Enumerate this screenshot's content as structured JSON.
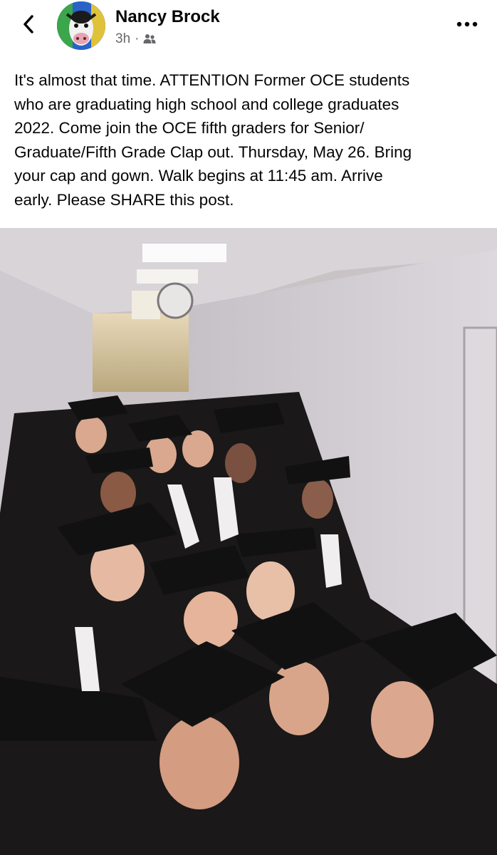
{
  "header": {
    "back_icon": "chevron-left-icon",
    "author_name": "Nancy Brock",
    "timestamp": "3h",
    "separator": "·",
    "audience_icon": "friends-icon",
    "more_icon": "more-horizontal-icon"
  },
  "post": {
    "text": "It's almost that time. ATTENTION Former OCE students\nwho are graduating high school and college graduates\n2022. Come join the OCE fifth graders for Senior/\nGraduate/Fifth Grade Clap out. Thursday, May 26. Bring\nyour cap and gown. Walk begins at 11:45 am. Arrive\nearly. Please SHARE this post."
  },
  "colors": {
    "text_primary": "#050505",
    "text_secondary": "#65676b",
    "background": "#ffffff"
  }
}
